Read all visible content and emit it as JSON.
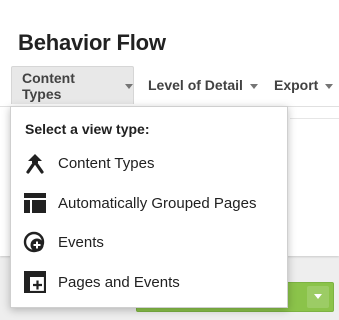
{
  "page_title": "Behavior Flow",
  "toolbar": {
    "content_types": "Content Types",
    "level_of_detail": "Level of Detail",
    "export": "Export"
  },
  "view_menu": {
    "heading": "Select a view type:",
    "items": [
      {
        "label": "Content Types",
        "icon": "content-types-icon"
      },
      {
        "label": "Automatically Grouped Pages",
        "icon": "grouped-pages-icon"
      },
      {
        "label": "Events",
        "icon": "events-icon"
      },
      {
        "label": "Pages and Events",
        "icon": "pages-and-events-icon"
      }
    ]
  },
  "colors": {
    "accent_green": "#8bc34a",
    "text": "#212121"
  }
}
